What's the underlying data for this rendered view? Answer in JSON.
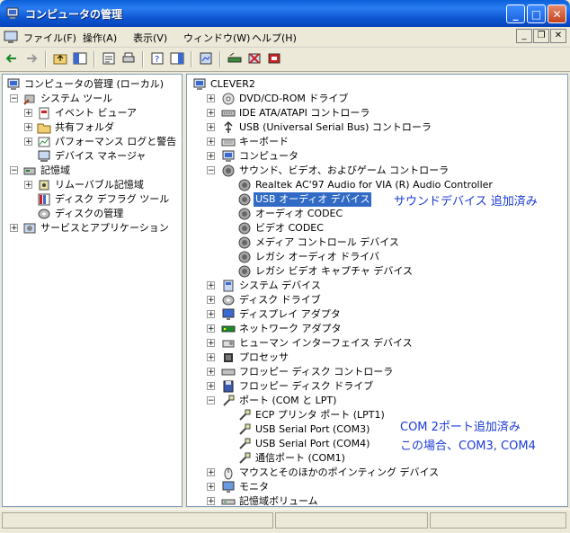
{
  "window": {
    "title": "コンピュータの管理"
  },
  "menu": [
    {
      "label": "ファイル(F)",
      "x": 0
    },
    {
      "label": "操作(A)"
    },
    {
      "label": "表示(V)"
    },
    {
      "label": "ウィンドウ(W)"
    },
    {
      "label": "ヘルプ(H)"
    }
  ],
  "window_controls": {
    "minimize": "_",
    "maximize": "□",
    "close": "✕"
  },
  "mdi_controls": {
    "minimize": "_",
    "restore": "❐",
    "close": "✕"
  },
  "left_tree": {
    "root": "コンピュータの管理 (ローカル)",
    "system_tools": "システム ツール",
    "event_viewer": "イベント ビューア",
    "shared_folders": "共有フォルダ",
    "perf_logs": "パフォーマンス ログと警告",
    "device_manager": "デバイス マネージャ",
    "storage": "記憶域",
    "removable": "リムーバブル記憶域",
    "defrag": "ディスク デフラグ ツール",
    "disk_mgmt": "ディスクの管理",
    "services": "サービスとアプリケーション"
  },
  "right_tree": {
    "root": "CLEVER2",
    "items": [
      "DVD/CD-ROM ドライブ",
      "IDE ATA/ATAPI コントローラ",
      "USB (Universal Serial Bus) コントローラ",
      "キーボード",
      "コンピュータ",
      "サウンド、ビデオ、およびゲーム コントローラ",
      "Realtek AC'97 Audio for VIA (R) Audio Controller",
      "USB オーディオ デバイス",
      "オーディオ CODEC",
      "ビデオ CODEC",
      "メディア コントロール デバイス",
      "レガシ オーディオ ドライバ",
      "レガシ ビデオ キャプチャ デバイス",
      "システム デバイス",
      "ディスク ドライブ",
      "ディスプレイ アダプタ",
      "ネットワーク アダプタ",
      "ヒューマン インターフェイス デバイス",
      "プロセッサ",
      "フロッピー ディスク コントローラ",
      "フロッピー ディスク ドライブ",
      "ポート (COM と LPT)",
      "ECP プリンタ ポート (LPT1)",
      "USB Serial Port (COM3)",
      "USB Serial Port (COM4)",
      "通信ポート (COM1)",
      "マウスとそのほかのポインティング デバイス",
      "モニタ",
      "記憶域ボリューム"
    ]
  },
  "annotations": {
    "sound": "サウンドデバイス 追加済み",
    "com_line1": "COM  2ポート追加済み",
    "com_line2": "この場合、COM3, COM4"
  }
}
